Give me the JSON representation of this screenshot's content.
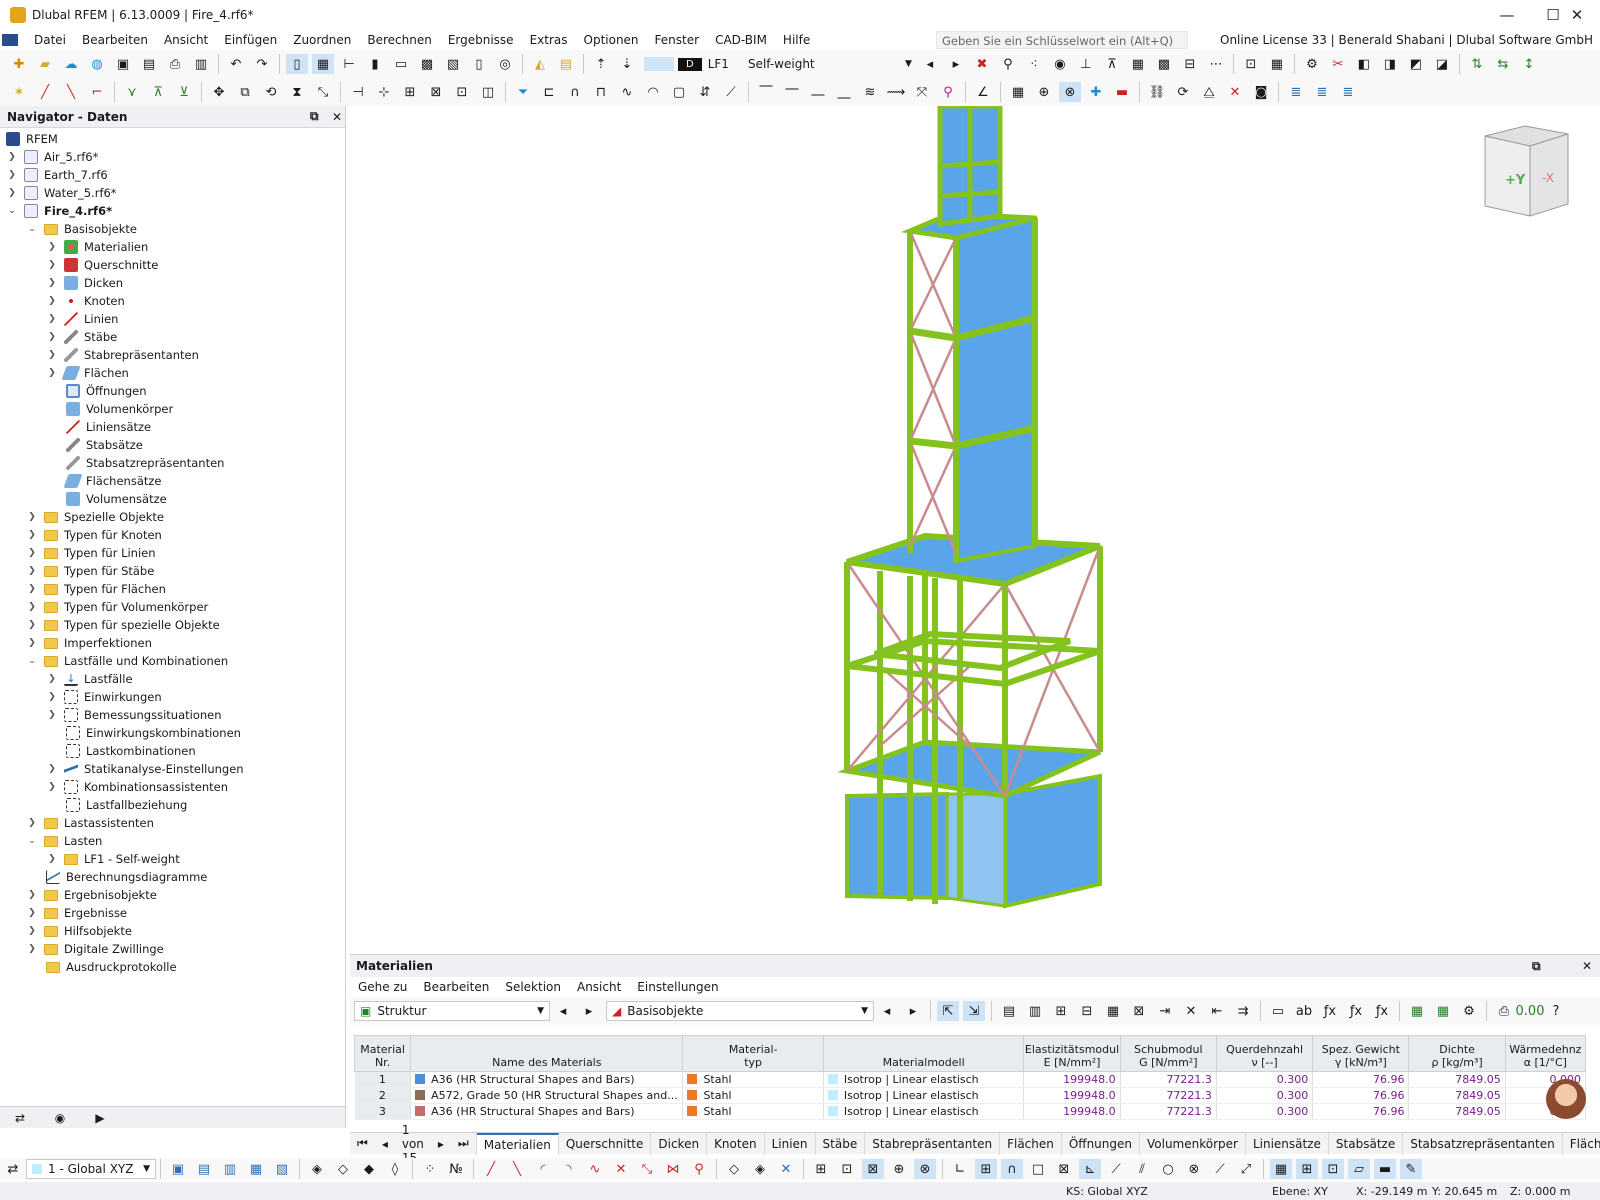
{
  "window": {
    "title": "Dlubal RFEM | 6.13.0009 | Fire_4.rf6*"
  },
  "menu": [
    "Datei",
    "Bearbeiten",
    "Ansicht",
    "Einfügen",
    "Zuordnen",
    "Berechnen",
    "Ergebnisse",
    "Extras",
    "Optionen",
    "Fenster",
    "CAD-BIM",
    "Hilfe"
  ],
  "search": {
    "placeholder": "Geben Sie ein Schlüsselwort ein (Alt+Q)"
  },
  "license": "Online License 33 | Benerald Shabani | Dlubal Software GmbH",
  "toolbar": {
    "loadcase_code": "D",
    "loadcase_id": "LF1",
    "loadcase_name": "Self-weight"
  },
  "navigator": {
    "title": "Navigator - Daten",
    "root": "RFEM",
    "files": [
      "Air_5.rf6*",
      "Earth_7.rf6",
      "Water_5.rf6*",
      "Fire_4.rf6*"
    ],
    "basis": "Basisobjekte",
    "basis_items": [
      "Materialien",
      "Querschnitte",
      "Dicken",
      "Knoten",
      "Linien",
      "Stäbe",
      "Stabrepräsentanten",
      "Flächen",
      "Öffnungen",
      "Volumenkörper",
      "Liniensätze",
      "Stabsätze",
      "Stabsatzrepräsentanten",
      "Flächensätze",
      "Volumensätze"
    ],
    "groups": [
      "Spezielle Objekte",
      "Typen für Knoten",
      "Typen für Linien",
      "Typen für Stäbe",
      "Typen für Flächen",
      "Typen für Volumenkörper",
      "Typen für spezielle Objekte",
      "Imperfektionen"
    ],
    "loads_group": "Lastfälle und Kombinationen",
    "loads_items": [
      "Lastfälle",
      "Einwirkungen",
      "Bemessungssituationen",
      "Einwirkungskombinationen",
      "Lastkombinationen",
      "Statikanalyse-Einstellungen",
      "Kombinationsassistenten",
      "Lastfallbeziehung"
    ],
    "lastassistenten": "Lastassistenten",
    "lasten": "Lasten",
    "lf1": "LF1 - Self-weight",
    "diagramme": "Berechnungsdiagramme",
    "tail": [
      "Ergebnisobjekte",
      "Ergebnisse",
      "Hilfsobjekte",
      "Digitale Zwillinge",
      "Ausdruckprotokolle"
    ]
  },
  "viewcube": {
    "plus_y": "+Y",
    "minus_x": "-X"
  },
  "panel": {
    "title": "Materialien",
    "menu": [
      "Gehe zu",
      "Bearbeiten",
      "Selektion",
      "Ansicht",
      "Einstellungen"
    ],
    "combo1": "Struktur",
    "combo2": "Basisobjekte",
    "columns": [
      [
        "Material",
        "Nr."
      ],
      [
        "",
        "Name des Materials"
      ],
      [
        "Material-",
        "typ"
      ],
      [
        "",
        "Materialmodell"
      ],
      [
        "Elastizitätsmodul",
        "E [N/mm²]"
      ],
      [
        "Schubmodul",
        "G [N/mm²]"
      ],
      [
        "Querdehnzahl",
        "ν [--]"
      ],
      [
        "Spez. Gewicht",
        "γ [kN/m³]"
      ],
      [
        "Dichte",
        "ρ [kg/m³]"
      ],
      [
        "Wärmedehnz",
        "α [1/°C]"
      ]
    ],
    "rows": [
      {
        "nr": "1",
        "name": "A36 (HR Structural Shapes and Bars)",
        "color": "#4a90d9",
        "typ": "Stahl",
        "model": "Isotrop | Linear elastisch",
        "E": "199948.0",
        "G": "77221.3",
        "nu": "0.300",
        "gamma": "76.96",
        "rho": "7849.05",
        "alpha": "0.000"
      },
      {
        "nr": "2",
        "name": "A572, Grade 50 (HR Structural Shapes and...",
        "color": "#8a6e5a",
        "typ": "Stahl",
        "model": "Isotrop | Linear elastisch",
        "E": "199948.0",
        "G": "77221.3",
        "nu": "0.300",
        "gamma": "76.96",
        "rho": "7849.05",
        "alpha": "0.000"
      },
      {
        "nr": "3",
        "name": "A36 (HR Structural Shapes and Bars)",
        "color": "#c96b6b",
        "typ": "Stahl",
        "model": "Isotrop | Linear elastisch",
        "E": "199948.0",
        "G": "77221.3",
        "nu": "0.300",
        "gamma": "76.96",
        "rho": "7849.05",
        "alpha": "0.000"
      }
    ],
    "pager": "1 von 15"
  },
  "tabs": [
    "Materialien",
    "Querschnitte",
    "Dicken",
    "Knoten",
    "Linien",
    "Stäbe",
    "Stabrepräsentanten",
    "Flächen",
    "Öffnungen",
    "Volumenkörper",
    "Liniensätze",
    "Stabsätze",
    "Stabsatzrepräsentanten",
    "Flächensä"
  ],
  "bottom": {
    "coord_system": "1 - Global XYZ"
  },
  "status": {
    "ks": "KS: Global XYZ",
    "plane": "Ebene: XY",
    "x": "X: -29.149 m",
    "y": "Y: 20.645 m",
    "z": "Z: 0.000 m"
  },
  "colors": {
    "steel_member": "#84c21d",
    "surface": "#5aa5ea",
    "bracing": "#c98b8b",
    "accent": "#2f6fb0"
  }
}
